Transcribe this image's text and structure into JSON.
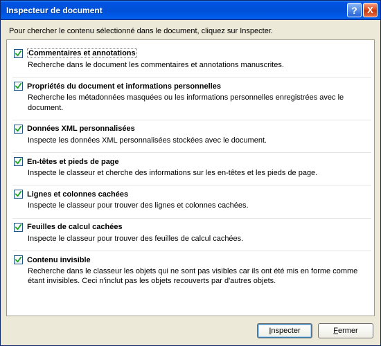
{
  "window": {
    "title": "Inspecteur de document"
  },
  "instruction": "Pour chercher le contenu sélectionné dans le document, cliquez sur Inspecter.",
  "items": [
    {
      "title": "Commentaires et annotations",
      "desc": "Recherche dans le document les commentaires et annotations manuscrites.",
      "checked": true,
      "selected": true
    },
    {
      "title": "Propriétés du document et informations personnelles",
      "desc": "Recherche les métadonnées masquées ou les informations personnelles enregistrées avec le document.",
      "checked": true,
      "selected": false
    },
    {
      "title": "Données XML personnalisées",
      "desc": "Inspecte les données XML personnalisées stockées avec le document.",
      "checked": true,
      "selected": false
    },
    {
      "title": "En-têtes et pieds de page",
      "desc": "Inspecte le classeur et cherche des informations sur les en-têtes et les pieds de page.",
      "checked": true,
      "selected": false
    },
    {
      "title": "Lignes et colonnes cachées",
      "desc": "Inspecte le classeur pour trouver des lignes et colonnes cachées.",
      "checked": true,
      "selected": false
    },
    {
      "title": "Feuilles de calcul cachées",
      "desc": "Inspecte le classeur pour trouver des feuilles de calcul cachées.",
      "checked": true,
      "selected": false
    },
    {
      "title": "Contenu invisible",
      "desc": "Recherche dans le classeur les objets qui ne sont pas visibles car ils ont été mis en forme comme étant invisibles. Ceci n'inclut pas les objets recouverts par d'autres objets.",
      "checked": true,
      "selected": false
    }
  ],
  "buttons": {
    "inspect": "Inspecter",
    "close": "Fermer"
  },
  "titlebar_buttons": {
    "help": "?",
    "close": "X"
  }
}
